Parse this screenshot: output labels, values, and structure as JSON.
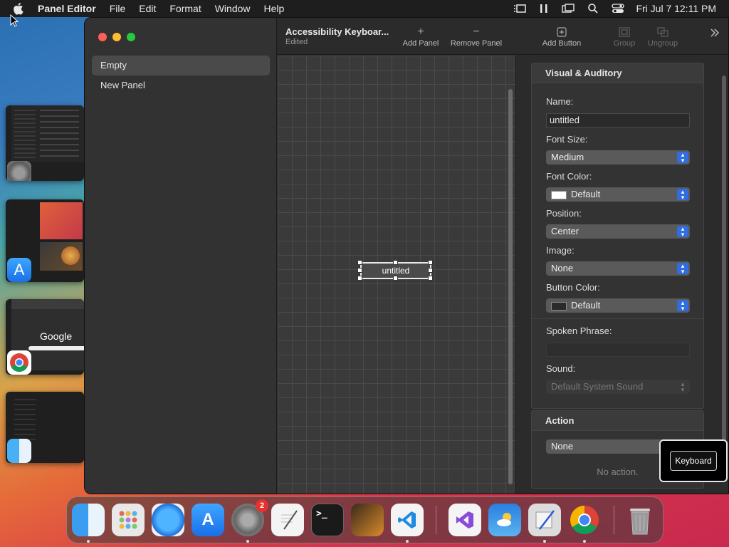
{
  "menubar": {
    "app_name": "Panel Editor",
    "items": [
      "File",
      "Edit",
      "Format",
      "Window",
      "Help"
    ],
    "clock": "Fri Jul 7  12:11 PM"
  },
  "sidebar": {
    "items": [
      {
        "label": "Empty",
        "selected": true
      },
      {
        "label": "New Panel",
        "selected": false
      }
    ]
  },
  "toolbar": {
    "title": "Accessibility Keyboar...",
    "subtitle": "Edited",
    "add_panel": "Add Panel",
    "remove_panel": "Remove Panel",
    "add_button": "Add Button",
    "group": "Group",
    "ungroup": "Ungroup"
  },
  "canvas": {
    "button_label": "untitled"
  },
  "inspector": {
    "visual": {
      "header": "Visual & Auditory",
      "name_label": "Name:",
      "name_value": "untitled",
      "font_size_label": "Font Size:",
      "font_size_value": "Medium",
      "font_color_label": "Font Color:",
      "font_color_value": "Default",
      "position_label": "Position:",
      "position_value": "Center",
      "image_label": "Image:",
      "image_value": "None",
      "button_color_label": "Button Color:",
      "button_color_value": "Default",
      "spoken_phrase_label": "Spoken Phrase:",
      "spoken_phrase_value": "",
      "sound_label": "Sound:",
      "sound_value": "Default System Sound"
    },
    "action": {
      "header": "Action",
      "value": "None",
      "empty_text": "No action."
    }
  },
  "floating": {
    "keyboard_label": "Keyboard"
  },
  "dock": {
    "apps": [
      "Finder",
      "Launchpad",
      "Safari",
      "App Store",
      "System Settings",
      "TextEdit",
      "Terminal",
      "GarageBand",
      "Visual Studio Code",
      "Visual Studio",
      "Weather",
      "Script Editor",
      "Chrome",
      "Trash"
    ],
    "settings_badge": "2"
  },
  "colors": {
    "accent": "#2f6de0",
    "close": "#ff5f57",
    "minimize": "#febc2e",
    "zoom": "#28c840"
  }
}
